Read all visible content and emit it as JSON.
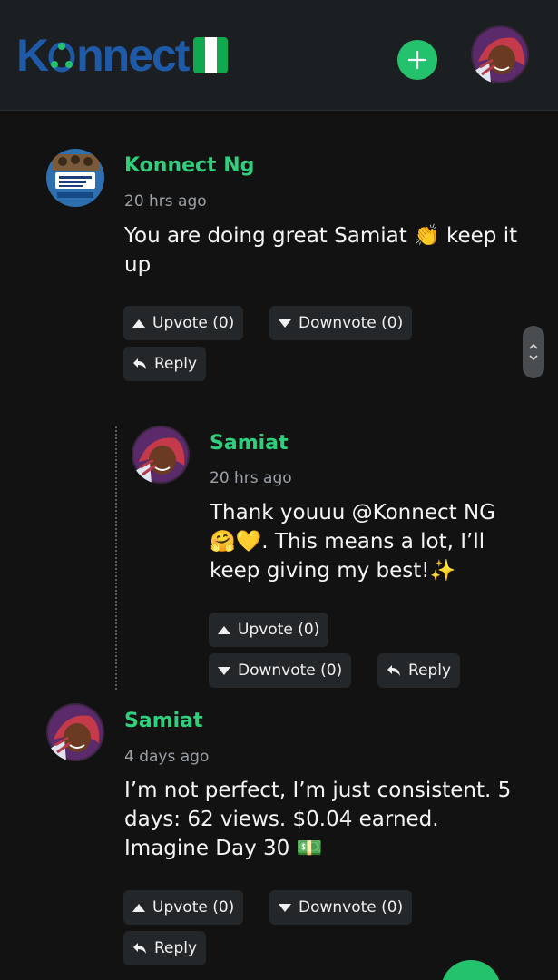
{
  "header": {
    "logo_text_k": "K",
    "logo_text_rest": "nnect",
    "add_icon": "plus-icon",
    "colors": {
      "accent": "#25c26e",
      "brand_blue": "#1f5aa8",
      "flag_green": "#11a94f"
    }
  },
  "comments": [
    {
      "author": "Konnect Ng",
      "time": "20 hrs ago",
      "text": "You are doing great Samiat 👏 keep it up",
      "upvote": "Upvote (0)",
      "downvote": "Downvote (0)",
      "reply": "Reply",
      "avatar_text": "Lambian youth Empowerment Programme"
    },
    {
      "author": "Samiat",
      "time": "20 hrs ago",
      "text": "Thank youuu @Konnect NG 🤗💛. This means a lot, I’ll keep giving my best!✨",
      "upvote": "Upvote (0)",
      "downvote": "Downvote (0)",
      "reply": "Reply"
    },
    {
      "author": "Samiat",
      "time": "4 days ago",
      "text": "I’m not perfect, I’m just consistent. 5 days: 62 views. $0.04 earned. Imagine Day 30 💵",
      "upvote": "Upvote (0)",
      "downvote": "Downvote (0)",
      "reply": "Reply"
    }
  ]
}
